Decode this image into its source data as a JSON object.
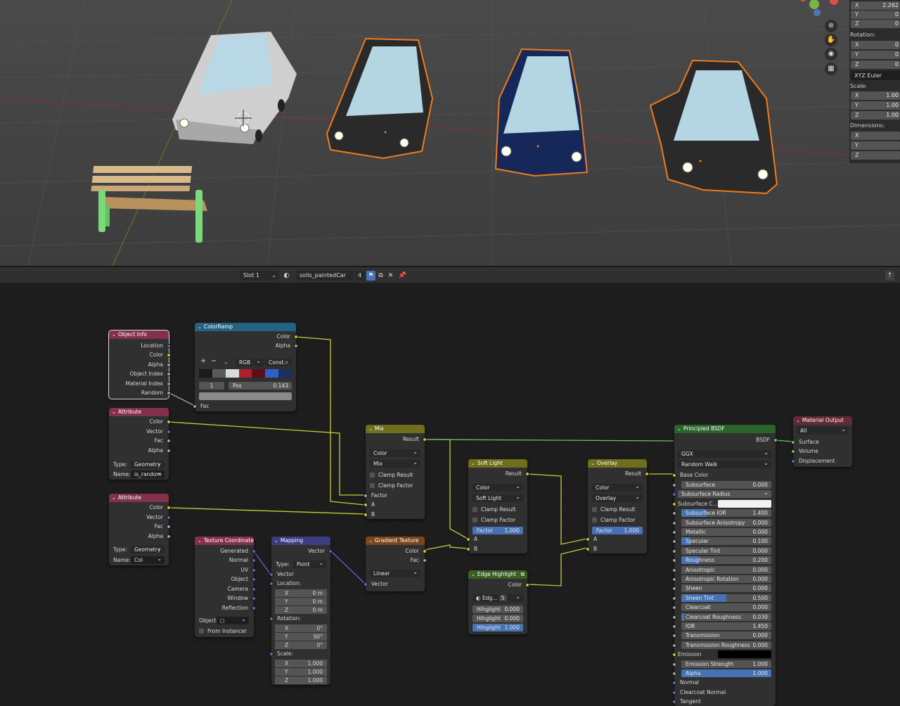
{
  "viewport": {
    "npanel": {
      "location": [
        {
          "axis": "X",
          "value": "2.262"
        },
        {
          "axis": "Y",
          "value": "0"
        },
        {
          "axis": "Z",
          "value": "0"
        }
      ],
      "rotation_label": "Rotation:",
      "rotation": [
        {
          "axis": "X",
          "value": "0"
        },
        {
          "axis": "Y",
          "value": "0"
        },
        {
          "axis": "Z",
          "value": "0"
        }
      ],
      "rotation_mode": "XYZ Euler",
      "scale_label": "Scale:",
      "scale": [
        {
          "axis": "X",
          "value": "1.00"
        },
        {
          "axis": "Y",
          "value": "1.00"
        },
        {
          "axis": "Z",
          "value": "1.00"
        }
      ],
      "dimensions_label": "Dimensions:",
      "dimensions": [
        {
          "axis": "X",
          "value": ""
        },
        {
          "axis": "Y",
          "value": ""
        },
        {
          "axis": "Z",
          "value": ""
        }
      ]
    },
    "nav_icons": [
      "zoom-icon",
      "hand-pan-icon",
      "camera-icon",
      "grid-view-icon"
    ],
    "colors": {
      "white_car": "#d9d9d9",
      "dark_car": "#2a2a2a",
      "blue_car": "#16285a",
      "selection": "#f07b1a",
      "bench_wood": "#d8b98a",
      "bench_frame": "#7ad97a"
    }
  },
  "header": {
    "slot": "Slot 1",
    "material_name": "solis_paintedCar",
    "user_count": "4"
  },
  "nodes": {
    "object_info": {
      "title": "Object Info",
      "outputs": [
        "Location",
        "Color",
        "Alpha",
        "Object Index",
        "Material Index",
        "Random"
      ]
    },
    "color_ramp": {
      "title": "ColorRamp",
      "outputs": [
        "Color",
        "Alpha"
      ],
      "plus": "+",
      "minus": "−",
      "mode": "RGB",
      "interp": "Const...",
      "index": "1",
      "pos_label": "Pos",
      "pos_value": "0.143",
      "input": "Fac"
    },
    "attribute1": {
      "title": "Attribute",
      "outputs": [
        "Color",
        "Vector",
        "Fac",
        "Alpha"
      ],
      "type_label": "Type:",
      "type_value": "Geometry",
      "name_label": "Name:",
      "name_value": "is_random"
    },
    "attribute2": {
      "title": "Attribute",
      "outputs": [
        "Color",
        "Vector",
        "Fac",
        "Alpha"
      ],
      "type_label": "Type:",
      "type_value": "Geometry",
      "name_label": "Name:",
      "name_value": "Col"
    },
    "mix": {
      "title": "Mix",
      "output": "Result",
      "data_type": "Color",
      "blend": "Mix",
      "clamp_result": "Clamp Result",
      "clamp_factor": "Clamp Factor",
      "inputs": [
        "Factor",
        "A",
        "B"
      ]
    },
    "soft_light": {
      "title": "Soft Light",
      "output": "Result",
      "data_type": "Color",
      "blend": "Soft Light",
      "clamp_result": "Clamp Result",
      "clamp_factor": "Clamp Factor",
      "factor_label": "Factor",
      "factor_value": "1.000",
      "factor": 1.0,
      "inputs": [
        "A",
        "B"
      ]
    },
    "overlay": {
      "title": "Overlay",
      "output": "Result",
      "data_type": "Color",
      "blend": "Overlay",
      "clamp_result": "Clamp Result",
      "clamp_factor": "Clamp Factor",
      "factor_label": "Factor",
      "factor_value": "1.000",
      "factor": 1.0,
      "inputs": [
        "A",
        "B"
      ]
    },
    "texture_coordinate": {
      "title": "Texture Coordinate",
      "outputs": [
        "Generated",
        "Normal",
        "UV",
        "Object",
        "Camera",
        "Window",
        "Reflection"
      ],
      "object_label": "Object:",
      "from_instancer": "From Instancer"
    },
    "mapping": {
      "title": "Mapping",
      "output": "Vector",
      "type_label": "Type:",
      "type_value": "Point",
      "input": "Vector",
      "location_label": "Location:",
      "location": [
        {
          "axis": "X",
          "value": "0 m"
        },
        {
          "axis": "Y",
          "value": "0 m"
        },
        {
          "axis": "Z",
          "value": "0 m"
        }
      ],
      "rotation_label": "Rotation:",
      "rotation": [
        {
          "axis": "X",
          "value": "0°"
        },
        {
          "axis": "Y",
          "value": "90°"
        },
        {
          "axis": "Z",
          "value": "0°"
        }
      ],
      "scale_label": "Scale:",
      "scale": [
        {
          "axis": "X",
          "value": "1.000"
        },
        {
          "axis": "Y",
          "value": "1.000"
        },
        {
          "axis": "Z",
          "value": "1.000"
        }
      ]
    },
    "gradient_texture": {
      "title": "Gradient Texture",
      "outputs": [
        "Color",
        "Fac"
      ],
      "type": "Linear",
      "input": "Vector"
    },
    "edge_highlight": {
      "title": "Edge Highlight",
      "output": "Color",
      "group_name": "Edg...",
      "group_users": "5",
      "inputs": [
        {
          "label": "Hihglight",
          "value": "0.000",
          "fill": 0.0
        },
        {
          "label": "Hihglight",
          "value": "0.000",
          "fill": 0.0
        },
        {
          "label": "Hihglight",
          "value": "1.000",
          "fill": 1.0
        }
      ]
    },
    "principled": {
      "title": "Principled BSDF",
      "output": "BSDF",
      "distribution": "GGX",
      "subsurface_method": "Random Walk",
      "base_color": "Base Color",
      "rows": [
        {
          "label": "Subsurface",
          "value": "0.000",
          "fill": 0.0,
          "socket": "float"
        },
        {
          "label": "Subsurface Radius",
          "value": "",
          "fill": 0.0,
          "socket": "vector",
          "dropdown": true
        },
        {
          "label": "Subsurface C...",
          "value": "",
          "fill": 0.0,
          "socket": "color",
          "swatch": "#f2f2f2"
        },
        {
          "label": "Subsurface IOR",
          "value": "1.400",
          "fill": 0.28,
          "socket": "float"
        },
        {
          "label": "Subsurface Anisotropy",
          "value": "0.000",
          "fill": 0.0,
          "socket": "float"
        },
        {
          "label": "Metallic",
          "value": "0.000",
          "fill": 0.0,
          "socket": "float"
        },
        {
          "label": "Specular",
          "value": "0.100",
          "fill": 0.1,
          "socket": "float"
        },
        {
          "label": "Specular Tint",
          "value": "0.000",
          "fill": 0.0,
          "socket": "float"
        },
        {
          "label": "Roughness",
          "value": "0.200",
          "fill": 0.2,
          "socket": "float"
        },
        {
          "label": "Anisotropic",
          "value": "0.000",
          "fill": 0.0,
          "socket": "float"
        },
        {
          "label": "Anisotropic Rotation",
          "value": "0.000",
          "fill": 0.0,
          "socket": "float"
        },
        {
          "label": "Sheen",
          "value": "0.000",
          "fill": 0.0,
          "socket": "float"
        },
        {
          "label": "Sheen Tint",
          "value": "0.500",
          "fill": 0.5,
          "socket": "float"
        },
        {
          "label": "Clearcoat",
          "value": "0.000",
          "fill": 0.0,
          "socket": "float"
        },
        {
          "label": "Clearcoat Roughness",
          "value": "0.030",
          "fill": 0.03,
          "socket": "float"
        },
        {
          "label": "IOR",
          "value": "1.450",
          "fill": 0.0,
          "socket": "float"
        },
        {
          "label": "Transmission",
          "value": "0.000",
          "fill": 0.0,
          "socket": "float"
        },
        {
          "label": "Transmission Roughness",
          "value": "0.000",
          "fill": 0.0,
          "socket": "float"
        },
        {
          "label": "Emission",
          "value": "",
          "fill": 0.0,
          "socket": "color",
          "swatch": "#000000"
        },
        {
          "label": "Emission Strength",
          "value": "1.000",
          "fill": 0.0,
          "socket": "float"
        },
        {
          "label": "Alpha",
          "value": "1.000",
          "fill": 1.0,
          "socket": "float"
        }
      ],
      "vector_inputs": [
        "Normal",
        "Clearcoat Normal",
        "Tangent"
      ]
    },
    "material_output": {
      "title": "Material Output",
      "target": "All",
      "inputs": [
        "Surface",
        "Volume",
        "Displacement"
      ]
    }
  },
  "colors": {
    "link_color": "#c8c83a",
    "link_vector": "#6363c7",
    "link_shader": "#63c763",
    "accent": "#4772b3"
  }
}
